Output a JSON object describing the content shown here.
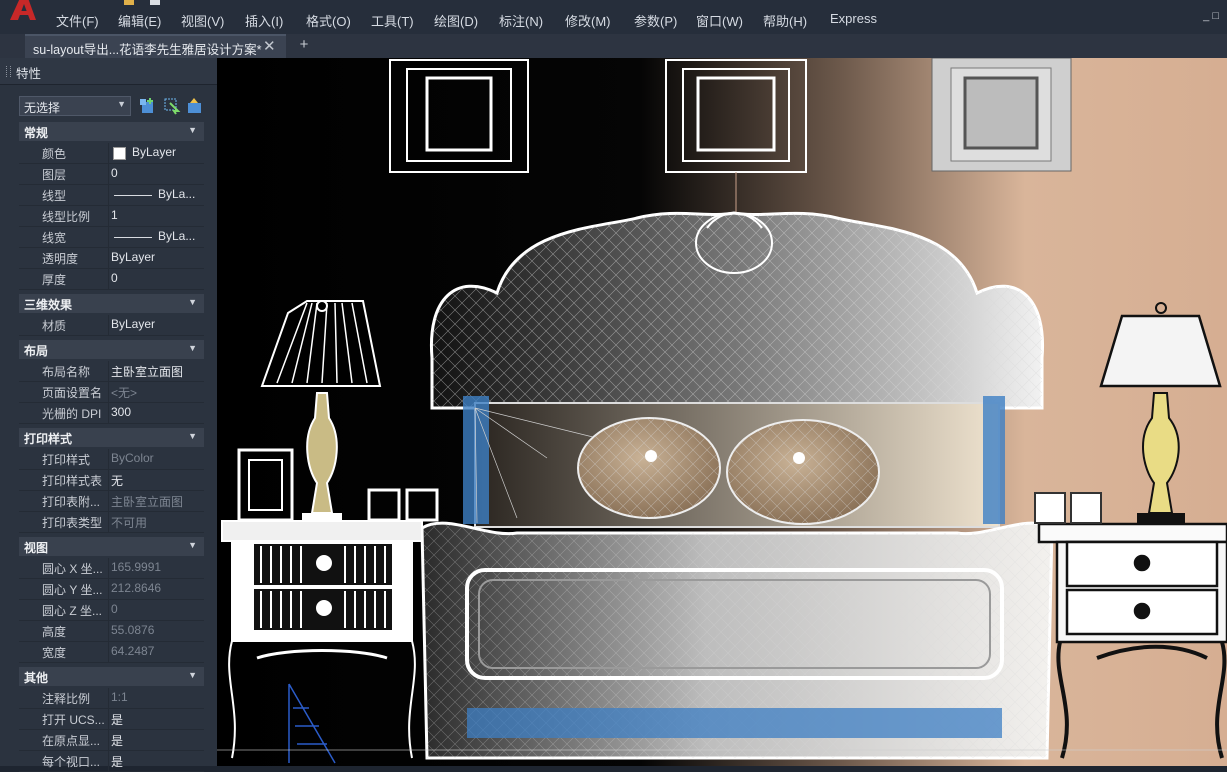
{
  "menu": [
    "文件(F)",
    "编辑(E)",
    "视图(V)",
    "插入(I)",
    "格式(O)",
    "工具(T)",
    "绘图(D)",
    "标注(N)",
    "修改(M)",
    "参数(P)",
    "窗口(W)",
    "帮助(H)",
    "Express"
  ],
  "tab": {
    "title": "su-layout导出...花语李先生雅居设计方案*",
    "close": "✕",
    "new": "+"
  },
  "panel": {
    "title": "特性",
    "selection": "无选择"
  },
  "sections": {
    "general": {
      "label": "常规",
      "rows": [
        {
          "label": "颜色",
          "value": "ByLayer"
        },
        {
          "label": "图层",
          "value": "0"
        },
        {
          "label": "线型",
          "value": "ByLa..."
        },
        {
          "label": "线型比例",
          "value": "1"
        },
        {
          "label": "线宽",
          "value": "ByLa..."
        },
        {
          "label": "透明度",
          "value": "ByLayer"
        },
        {
          "label": "厚度",
          "value": "0"
        }
      ]
    },
    "effects3d": {
      "label": "三维效果",
      "rows": [
        {
          "label": "材质",
          "value": "ByLayer"
        }
      ]
    },
    "layout": {
      "label": "布局",
      "rows": [
        {
          "label": "布局名称",
          "value": "主卧室立面图"
        },
        {
          "label": "页面设置名",
          "value": "<无>"
        },
        {
          "label": "光栅的 DPI",
          "value": "300"
        }
      ]
    },
    "plotstyle": {
      "label": "打印样式",
      "rows": [
        {
          "label": "打印样式",
          "value": "ByColor"
        },
        {
          "label": "打印样式表",
          "value": "无"
        },
        {
          "label": "打印表附...",
          "value": "主卧室立面图"
        },
        {
          "label": "打印表类型",
          "value": "不可用"
        }
      ]
    },
    "view": {
      "label": "视图",
      "rows": [
        {
          "label": "圆心 X 坐...",
          "value": "165.9991"
        },
        {
          "label": "圆心 Y 坐...",
          "value": "212.8646"
        },
        {
          "label": "圆心 Z 坐...",
          "value": "0"
        },
        {
          "label": "高度",
          "value": "55.0876"
        },
        {
          "label": "宽度",
          "value": "64.2487"
        }
      ]
    },
    "misc": {
      "label": "其他",
      "rows": [
        {
          "label": "注释比例",
          "value": "1:1"
        },
        {
          "label": "打开 UCS...",
          "value": "是"
        },
        {
          "label": "在原点显...",
          "value": "是"
        },
        {
          "label": "每个视口...",
          "value": "是"
        }
      ]
    }
  },
  "colors": {
    "accent": "#c62828",
    "panel_bg": "#2b333f",
    "section_bg": "#39414e",
    "wall": "#d9b59a",
    "selection_blue": "#3d7fc4"
  },
  "icons": [
    "app-logo-icon",
    "quick-access-icon",
    "quick-select-icon",
    "select-objects-icon",
    "toggle-pickadd-icon",
    "dropdown-caret-icon",
    "collapse-caret-icon",
    "close-icon",
    "add-tab-icon"
  ]
}
